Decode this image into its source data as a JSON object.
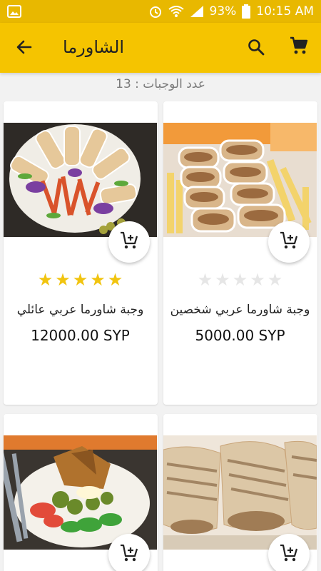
{
  "status_bar": {
    "battery": "93%",
    "time": "10:15 AM",
    "icons": [
      "image-icon",
      "alarm-icon",
      "wifi-icon",
      "signal-icon",
      "battery-icon"
    ]
  },
  "app_bar": {
    "title": "الشاورما",
    "icons": [
      "back-arrow-icon",
      "search-icon",
      "cart-icon"
    ]
  },
  "meals_count": "عدد الوجبات : 13",
  "products": [
    {
      "name": "وجبة شاورما عربي شخصين",
      "price": "5000.00 SYP",
      "rating": 0,
      "max_rating": 5,
      "image": "shawarma-rolls-fries"
    },
    {
      "name": "وجبة شاورما عربي عائلي",
      "price": "12000.00 SYP",
      "rating": 5,
      "max_rating": 5,
      "image": "shawarma-family-platter"
    },
    {
      "image": "grilled-wraps"
    },
    {
      "image": "plate-with-salad"
    }
  ],
  "colors": {
    "status_bar": "#e8b800",
    "app_bar": "#f5c400",
    "star_on": "#f1c40f",
    "star_off": "#e6e6e6"
  }
}
